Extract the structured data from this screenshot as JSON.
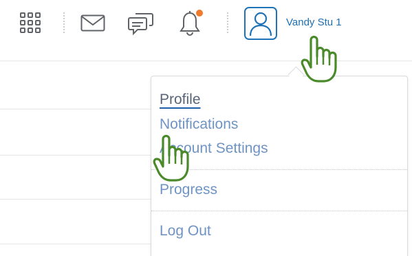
{
  "header": {
    "user_name": "Vandy Stu 1",
    "notification_badge_color": "#f07a2b",
    "icons": [
      "apps-grid-icon",
      "mail-icon",
      "chat-icon",
      "bell-icon",
      "user-avatar-icon"
    ]
  },
  "menu": {
    "items": [
      {
        "label": "Profile"
      },
      {
        "label": "Notifications"
      },
      {
        "label": "Account Settings"
      },
      {
        "label": "Progress"
      },
      {
        "label": "Log Out"
      }
    ]
  },
  "annotations": {
    "pointer_icons": [
      "hand-pointer-icon",
      "hand-pointer-icon"
    ],
    "pointer_color": "#4a8a2a"
  }
}
